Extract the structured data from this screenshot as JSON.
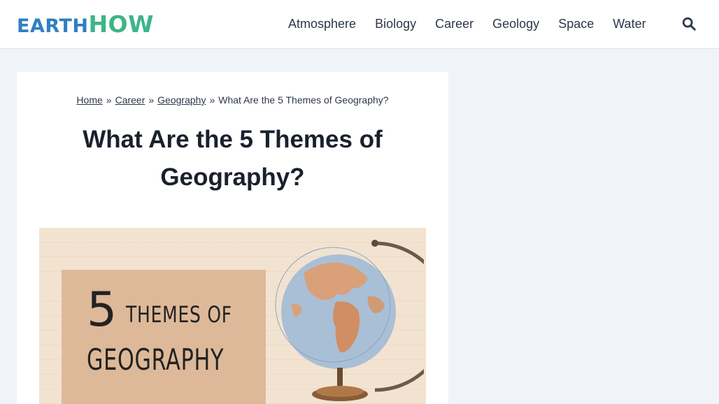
{
  "header": {
    "logo": {
      "part1": "EARTH",
      "part2": "HOW"
    },
    "nav": [
      "Atmosphere",
      "Biology",
      "Career",
      "Geology",
      "Space",
      "Water"
    ],
    "search_icon": "search-icon"
  },
  "breadcrumb": {
    "items": [
      "Home",
      "Career",
      "Geography"
    ],
    "separator": "»",
    "current": "What Are the 5 Themes of Geography?"
  },
  "article": {
    "title": "What Are the 5 Themes of Geography?",
    "hero": {
      "number": "5",
      "line1": "THEMES OF",
      "line2": "GEOGRAPHY"
    }
  },
  "colors": {
    "logo_blue": "#2f7fc1",
    "logo_green": "#3eb489",
    "page_bg": "#f0f4f8",
    "hero_bg": "#f2e3d0",
    "hero_box": "#ddb999"
  }
}
